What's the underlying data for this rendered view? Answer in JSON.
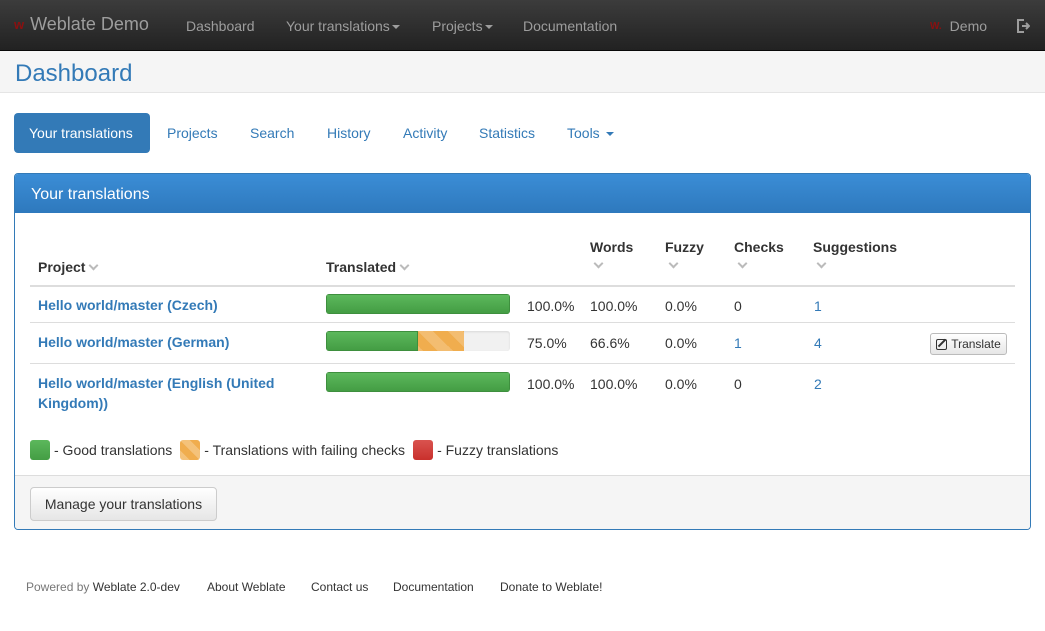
{
  "navbar": {
    "brand": "Weblate Demo",
    "brand_logo": "w",
    "items": [
      {
        "label": "Dashboard"
      },
      {
        "label": "Your translations"
      },
      {
        "label": "Projects"
      },
      {
        "label": "Documentation"
      }
    ],
    "user": "Demo",
    "user_logo": "W.",
    "logout_icon": "logout-icon"
  },
  "page": {
    "title": "Dashboard"
  },
  "tabs": [
    {
      "label": "Your translations",
      "active": true
    },
    {
      "label": "Projects"
    },
    {
      "label": "Search"
    },
    {
      "label": "History"
    },
    {
      "label": "Activity"
    },
    {
      "label": "Statistics"
    },
    {
      "label": "Tools"
    }
  ],
  "panel": {
    "title": "Your translations",
    "columns": {
      "project": "Project",
      "translated": "Translated",
      "words": "Words",
      "fuzzy": "Fuzzy",
      "checks": "Checks",
      "suggestions": "Suggestions"
    },
    "rows": [
      {
        "project": "Hello world/master (Czech)",
        "translated_pct": 100.0,
        "translated": "100.0%",
        "words": "100.0%",
        "fuzzy": "0.0%",
        "checks": "0",
        "suggestions": "1",
        "failing_checks_pct": 0
      },
      {
        "project": "Hello world/master (German)",
        "translated_pct": 50.0,
        "translated": "75.0%",
        "words": "66.6%",
        "fuzzy": "0.0%",
        "checks": "1",
        "suggestions": "4",
        "failing_checks_pct": 25.0,
        "action": "Translate"
      },
      {
        "project": "Hello world/master (English (United Kingdom))",
        "translated_pct": 100.0,
        "translated": "100.0%",
        "words": "100.0%",
        "fuzzy": "0.0%",
        "checks": "0",
        "suggestions": "2",
        "failing_checks_pct": 0
      }
    ],
    "legend": {
      "good": "- Good translations",
      "checks": "- Translations with failing checks",
      "fuzzy": "- Fuzzy translations"
    },
    "manage_button": "Manage your translations"
  },
  "colors": {
    "accent": "#337ab7",
    "good": "#5cb85c",
    "failing_checks": "#f0ad4e",
    "fuzzy": "#d9534f"
  },
  "footer": {
    "powered_by": "Powered by",
    "version": "Weblate 2.0-dev",
    "links": [
      "About Weblate",
      "Contact us",
      "Documentation",
      "Donate to Weblate!"
    ]
  }
}
